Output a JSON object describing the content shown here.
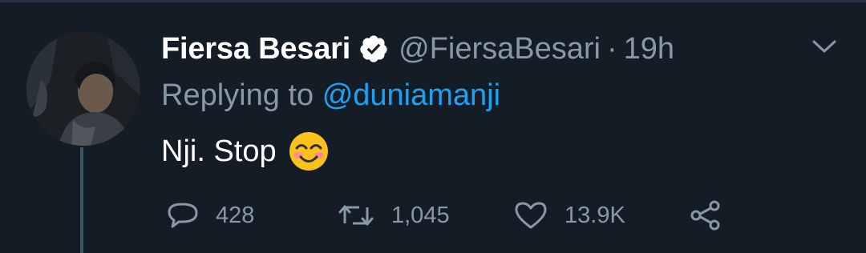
{
  "tweet": {
    "display_name": "Fiersa Besari",
    "handle": "@FiersaBesari",
    "separator": "·",
    "time": "19h",
    "replying_to_label": "Replying to",
    "replying_to_handle": "@duniamanji",
    "text": "Nji. Stop",
    "emoji": "smiling-face-with-smiling-eyes"
  },
  "actions": {
    "reply_count": "428",
    "retweet_count": "1,045",
    "like_count": "13.9K"
  },
  "icons": {
    "verified": "verified-badge-icon",
    "menu": "chevron-down-icon",
    "reply": "reply-icon",
    "retweet": "retweet-icon",
    "like": "heart-icon",
    "share": "share-icon"
  },
  "colors": {
    "background": "#141d26",
    "link": "#1da1f2",
    "secondary_text": "#8899a6",
    "primary_text": "#ffffff"
  }
}
